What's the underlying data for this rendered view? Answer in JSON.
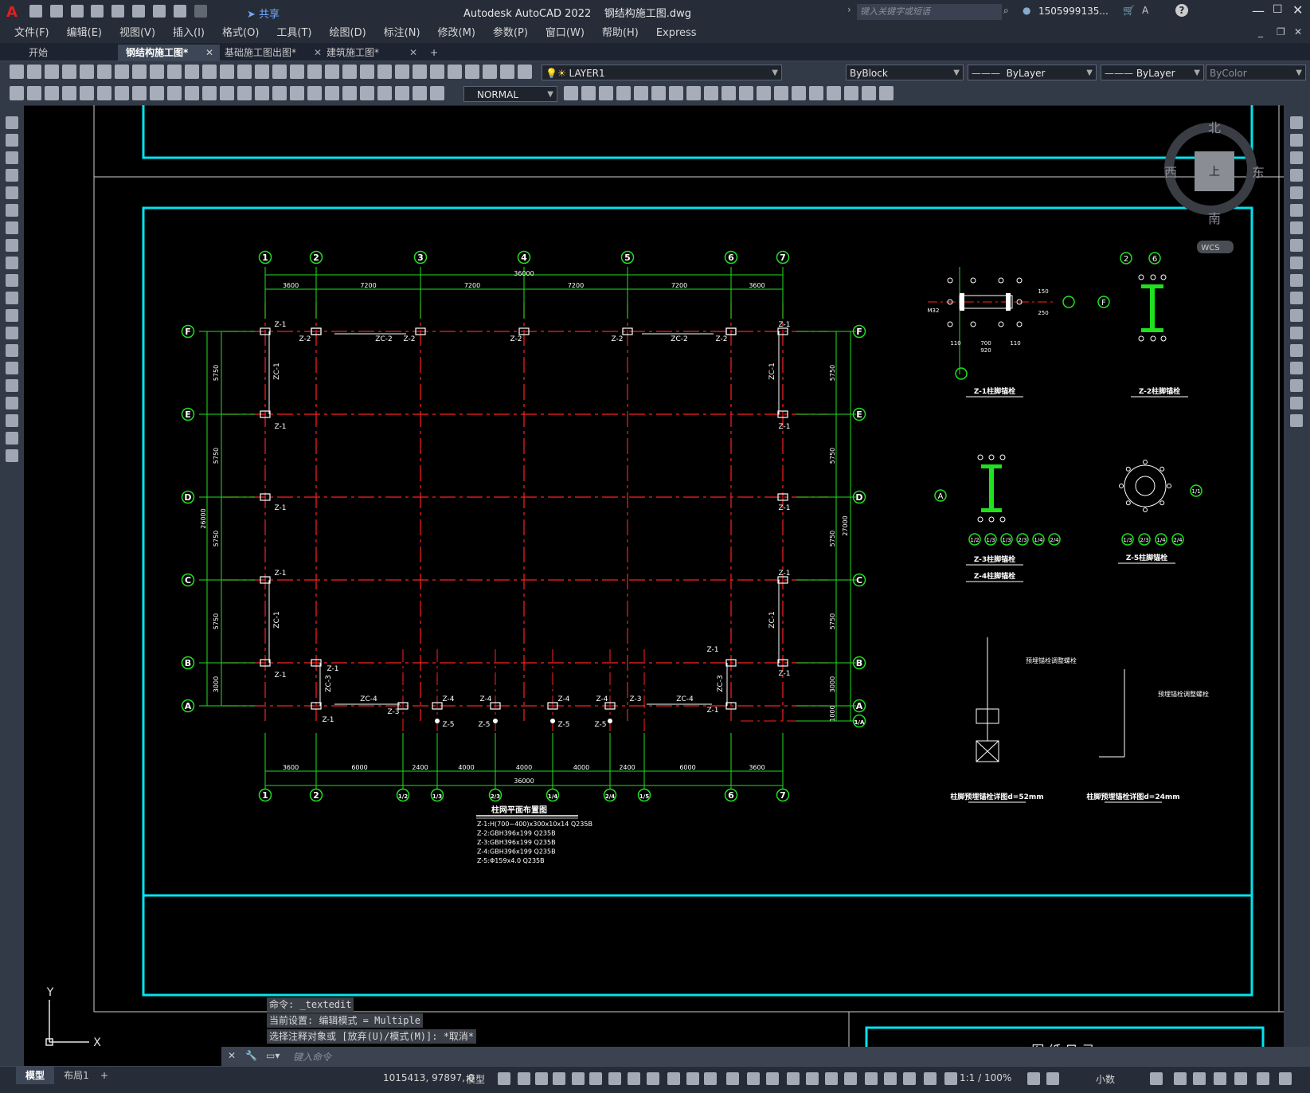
{
  "app": {
    "title": "Autodesk AutoCAD 2022",
    "file": "钢结构施工图.dwg",
    "search_placeholder": "键入关键字或短语",
    "user": "1505999135...",
    "share_label": "共享"
  },
  "menu": [
    "文件(F)",
    "编辑(E)",
    "视图(V)",
    "插入(I)",
    "格式(O)",
    "工具(T)",
    "绘图(D)",
    "标注(N)",
    "修改(M)",
    "参数(P)",
    "窗口(W)",
    "帮助(H)",
    "Express"
  ],
  "tabs": [
    {
      "label": "开始"
    },
    {
      "label": "钢结构施工图*"
    },
    {
      "label": "基础施工图出图*"
    },
    {
      "label": "建筑施工图*"
    }
  ],
  "toolbar": {
    "layer": "LAYER1",
    "color": "ByBlock",
    "linetype": "ByLayer",
    "lineweight": "ByLayer",
    "plotstyle": "ByColor",
    "textstyle": "NORMAL"
  },
  "viewcube": {
    "north": "北",
    "south": "南",
    "east": "东",
    "west": "西",
    "top": "上",
    "wcs": "WCS"
  },
  "drawing": {
    "grid_top": [
      "1",
      "2",
      "3",
      "4",
      "5",
      "6",
      "7"
    ],
    "grid_bottom": [
      "1",
      "2",
      "1/2",
      "1/3",
      "2/3",
      "1/4",
      "2/4",
      "1/5",
      "6",
      "7"
    ],
    "grid_rows": [
      "F",
      "E",
      "D",
      "C",
      "B",
      "A"
    ],
    "dims_top": [
      "3600",
      "7200",
      "7200",
      "7200",
      "7200",
      "3600"
    ],
    "dim_top_total": "36000",
    "dims_bottom": [
      "3600",
      "6000",
      "2400",
      "4000",
      "4000",
      "4000",
      "2400",
      "6000",
      "3600"
    ],
    "dim_bottom_total": "36000",
    "dims_left": [
      "5750",
      "5750",
      "5750",
      "5750",
      "3000"
    ],
    "dim_left_total": "26000",
    "dims_right": [
      "5750",
      "5750",
      "5750",
      "5750",
      "3000",
      "1000"
    ],
    "dim_right_total": "27000",
    "plan_title": "柱网平面布置图",
    "legend": [
      "Z-1:H(700~400)x300x10x14 Q235B",
      "Z-2:GBH396x199 Q235B",
      "Z-3:GBH396x199 Q235B",
      "Z-4:GBH396x199 Q235B",
      "Z-5:Φ159x4.0 Q235B"
    ],
    "detail_titles": [
      "Z-1柱脚锚栓",
      "Z-2柱脚锚栓",
      "Z-3柱脚锚栓",
      "Z-4柱脚锚栓",
      "Z-5柱脚锚栓",
      "柱脚预埋锚栓详图d=52mm",
      "柱脚预埋锚栓详图d=24mm"
    ],
    "detail_notes": [
      "预埋锚栓调整螺栓",
      "预埋锚栓调整螺栓"
    ],
    "catalog_title": "图 纸 目 录"
  },
  "command": {
    "history": [
      "命令: _textedit",
      "当前设置: 编辑模式 = Multiple",
      "选择注释对象或 [放弃(U)/模式(M)]: *取消*"
    ],
    "placeholder": "键入命令"
  },
  "status": {
    "layout_tabs": [
      "模型",
      "布局1"
    ],
    "coords": "1015413, 97897, 0",
    "mode": "模型",
    "scale": "1:1 / 100%",
    "units": "小数"
  },
  "colors": {
    "frame": "#00e5f0",
    "grid": "#ff2020",
    "dim": "#20e020",
    "white": "#ffffff",
    "bg": "#000000",
    "chrome": "#262d38"
  }
}
